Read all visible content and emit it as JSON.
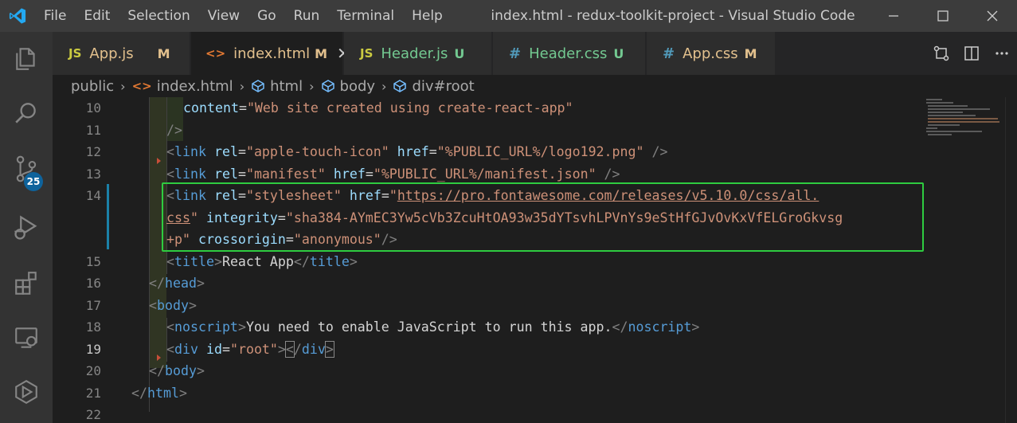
{
  "window": {
    "title": "index.html - redux-toolkit-project - Visual Studio Code"
  },
  "menu": [
    "File",
    "Edit",
    "Selection",
    "View",
    "Go",
    "Run",
    "Terminal",
    "Help"
  ],
  "activity_bar": {
    "icons": [
      "explorer-icon",
      "search-icon",
      "source-control-icon",
      "run-debug-icon",
      "extensions-icon",
      "remote-explorer-icon",
      "docker-icon"
    ],
    "scm_badge": "25",
    "badge_color": "#0e639c"
  },
  "tabs": [
    {
      "icon": "JS",
      "label": "App.js",
      "status": "M",
      "icon_color": "#cbcb41",
      "label_color": "#e2c08d",
      "active": false
    },
    {
      "icon": "<>",
      "label": "index.html",
      "status": "M",
      "icon_color": "#e37933",
      "label_color": "#e2c08d",
      "active": true,
      "close": "✕"
    },
    {
      "icon": "JS",
      "label": "Header.js",
      "status": "U",
      "icon_color": "#cbcb41",
      "label_color": "#73c991",
      "active": false
    },
    {
      "icon": "#",
      "label": "Header.css",
      "status": "U",
      "icon_color": "#519aba",
      "label_color": "#73c991",
      "active": false
    },
    {
      "icon": "#",
      "label": "App.css",
      "status": "M",
      "icon_color": "#519aba",
      "label_color": "#e2c08d",
      "active": false
    }
  ],
  "breadcrumb": [
    "public",
    "index.html",
    "html",
    "body",
    "div#root"
  ],
  "editor": {
    "current_line": "19",
    "highlight_color": "#2ecc40",
    "lines": [
      {
        "num": "10"
      },
      {
        "num": "11"
      },
      {
        "num": "12"
      },
      {
        "num": "13"
      },
      {
        "num": "14"
      },
      {
        "num": ""
      },
      {
        "num": ""
      },
      {
        "num": "15"
      },
      {
        "num": "16"
      },
      {
        "num": "17"
      },
      {
        "num": "18"
      },
      {
        "num": "19"
      },
      {
        "num": "20"
      },
      {
        "num": "21"
      },
      {
        "num": "22"
      }
    ],
    "code": {
      "l10_attr": "content",
      "l10_val": "\"Web site created using create-react-app\"",
      "l11": "/>",
      "l12_tag": "link",
      "l12_a1": "rel",
      "l12_v1": "\"apple-touch-icon\"",
      "l12_a2": "href",
      "l12_v2": "\"%PUBLIC_URL%/logo192.png\"",
      "l12_end": " />",
      "l13_tag": "link",
      "l13_a1": "rel",
      "l13_v1": "\"manifest\"",
      "l13_a2": "href",
      "l13_v2": "\"%PUBLIC_URL%/manifest.json\"",
      "l13_end": " />",
      "l14_tag": "link",
      "l14_a1": "rel",
      "l14_v1": "\"stylesheet\"",
      "l14_a2": "href",
      "l14_q": "\"",
      "l14_url1": "https://pro.fontawesome.com/releases/v5.10.0/css/all.",
      "l14_url2": "css",
      "l14_a3": "integrity",
      "l14_v3a": "\"sha384-AYmEC3Yw5cVb3ZcuHtOA93w35dYTsvhLPVnYs9eStHfGJvOvKxVfELGroGkvsg",
      "l14_v3b": "+p\"",
      "l14_a4": "crossorigin",
      "l14_v4": "\"anonymous\"",
      "l14_end": "/>",
      "l15_tag": "title",
      "l15_text": "React App",
      "l16_tag": "head",
      "l17_tag": "body",
      "l18_tag": "noscript",
      "l18_text": "You need to enable JavaScript to run this app.",
      "l19_tag": "div",
      "l19_attr": "id",
      "l19_val": "\"root\"",
      "l20_tag": "body",
      "l21_tag": "html"
    }
  }
}
